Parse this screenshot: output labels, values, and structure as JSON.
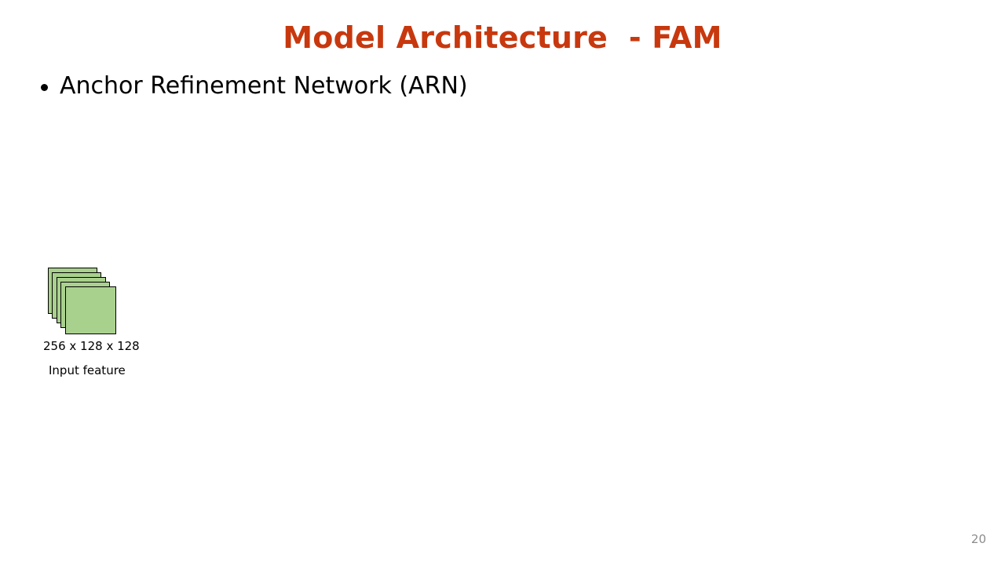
{
  "slide": {
    "title": "Model Architecture  - FAM",
    "bullet": "Anchor Refinement Network (ARN)",
    "diagram": {
      "feature_size_label": "256 x 128 x 128",
      "feature_name_label": "Input feature"
    },
    "page_number": "20",
    "colors": {
      "title": "#c8380e",
      "feature_fill": "#a9d18e",
      "page_number": "#8c8c8c"
    }
  }
}
